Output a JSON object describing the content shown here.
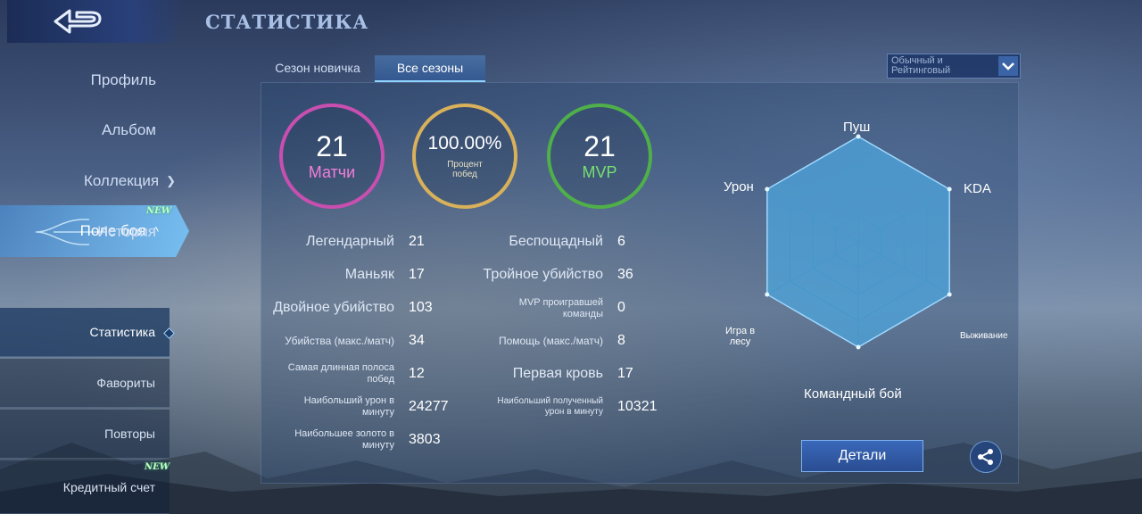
{
  "header": {
    "title": "СТАТИСТИКА"
  },
  "sidebar": {
    "items": [
      {
        "label": "Профиль"
      },
      {
        "label": "Альбом"
      },
      {
        "label": "Коллекция"
      },
      {
        "label": "История"
      }
    ],
    "active_item": {
      "label": "Поле боя",
      "badge": "NEW"
    },
    "sub_items": [
      {
        "label": "Статистика"
      },
      {
        "label": "Фавориты"
      },
      {
        "label": "Повторы"
      },
      {
        "label": "Кредитный счет",
        "badge": "NEW"
      }
    ]
  },
  "tabs": [
    {
      "label": "Сезон новичка"
    },
    {
      "label": "Все сезоны"
    }
  ],
  "dropdown": {
    "selected": "Обычный и\nРейтинговый"
  },
  "summary": {
    "matches": {
      "value": "21",
      "label": "Матчи"
    },
    "winrate": {
      "value": "100.00%",
      "label": "Процент\nпобед"
    },
    "mvp": {
      "value": "21",
      "label": "MVP"
    }
  },
  "stats_left": [
    {
      "label": "Легендарный",
      "value": "21"
    },
    {
      "label": "Маньяк",
      "value": "17"
    },
    {
      "label": "Двойное убийство",
      "value": "103"
    },
    {
      "label": "Убийства (макс./матч)",
      "value": "34"
    },
    {
      "label": "Самая длинная полоса\nпобед",
      "value": "12"
    },
    {
      "label": "Наибольший урон в\nминуту",
      "value": "24277"
    },
    {
      "label": "Наибольшее золото в\nминуту",
      "value": "3803"
    }
  ],
  "stats_right": [
    {
      "label": "Беспощадный",
      "value": "6"
    },
    {
      "label": "Тройное убийство",
      "value": "36"
    },
    {
      "label": "MVP проигравшей\nкоманды",
      "value": "0"
    },
    {
      "label": "Помощь (макс./матч)",
      "value": "8"
    },
    {
      "label": "Первая кровь",
      "value": "17"
    },
    {
      "label": "Наибольший полученный\nурон в минуту",
      "value": "10321"
    }
  ],
  "radar": {
    "axes": [
      "Пуш",
      "KDA",
      "Выживание",
      "Командный бой",
      "Игра в\nлесу",
      "Урон"
    ],
    "values": [
      1.0,
      1.0,
      1.0,
      1.0,
      1.0,
      1.0
    ],
    "fill_color": "#4ea6dc"
  },
  "buttons": {
    "details": "Детали"
  },
  "icons": {
    "back": "back-arrow-icon",
    "share": "share-icon",
    "dropdown": "chevron-down-icon"
  },
  "colors": {
    "matches_ring": "#c84fb0",
    "winrate_ring": "#d8b15a",
    "mvp_ring": "#4fb04a",
    "accent": "#8fd3ff"
  }
}
